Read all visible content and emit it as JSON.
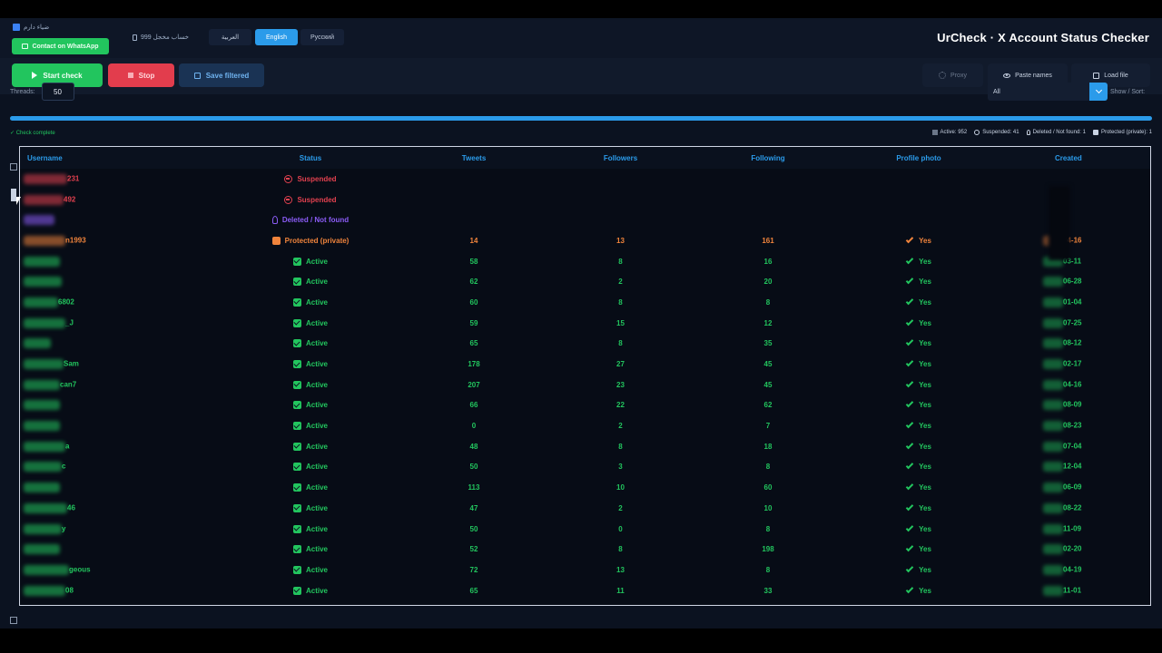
{
  "header": {
    "user_name": "ضياء دارم",
    "whatsapp_label": "Contact on WhatsApp",
    "accounts_label": "خساب مخجل 999",
    "languages": [
      {
        "label": "العربية",
        "active": false
      },
      {
        "label": "English",
        "active": true
      },
      {
        "label": "Русский",
        "active": false
      }
    ],
    "app_title": "UrCheck  ·  X Account Status Checker"
  },
  "toolbar": {
    "start_label": "Start check",
    "stop_label": "Stop",
    "save_label": "Save filtered",
    "proxy_label": "Proxy",
    "paste_label": "Paste names",
    "load_label": "Load file"
  },
  "controls": {
    "threads_label": "Threads:",
    "threads_value": "50",
    "filter_value": "All",
    "sort_label": "Show / Sort:"
  },
  "progress": {
    "fraction": 1.0,
    "status_text": "✓ Check complete",
    "stats": [
      {
        "label": "Active: 952",
        "color": "#c9d3e3"
      },
      {
        "label": "Suspended: 41",
        "color": "#c9d3e3"
      },
      {
        "label": "Deleted / Not found: 1",
        "color": "#c9d3e3"
      },
      {
        "label": "Protected (private): 1",
        "color": "#c9d3e3"
      }
    ]
  },
  "table": {
    "columns": [
      "Username",
      "Status",
      "Tweets",
      "Followers",
      "Following",
      "Profile photo",
      "Created"
    ],
    "rows": [
      {
        "user_suffix": "231",
        "status": "Suspended",
        "type": "suspended",
        "tweets": "",
        "followers": "",
        "following": "",
        "photo": "",
        "created": ""
      },
      {
        "user_suffix": "492",
        "status": "Suspended",
        "type": "suspended",
        "tweets": "",
        "followers": "",
        "following": "",
        "photo": "",
        "created": ""
      },
      {
        "user_suffix": "",
        "status": "Deleted / Not found",
        "type": "deleted",
        "tweets": "",
        "followers": "",
        "following": "",
        "photo": "",
        "created": ""
      },
      {
        "user_suffix": "n1993",
        "status": "Protected (private)",
        "type": "protected",
        "tweets": "14",
        "followers": "13",
        "following": "161",
        "photo": "Yes",
        "created": "04-16"
      },
      {
        "user_suffix": "",
        "status": "Active",
        "type": "active",
        "tweets": "58",
        "followers": "8",
        "following": "16",
        "photo": "Yes",
        "created": "03-11"
      },
      {
        "user_suffix": "",
        "status": "Active",
        "type": "active",
        "tweets": "62",
        "followers": "2",
        "following": "20",
        "photo": "Yes",
        "created": "06-28"
      },
      {
        "user_suffix": "6802",
        "status": "Active",
        "type": "active",
        "tweets": "60",
        "followers": "8",
        "following": "8",
        "photo": "Yes",
        "created": "01-04"
      },
      {
        "user_suffix": "_J",
        "status": "Active",
        "type": "active",
        "tweets": "59",
        "followers": "15",
        "following": "12",
        "photo": "Yes",
        "created": "07-25"
      },
      {
        "user_suffix": "",
        "status": "Active",
        "type": "active",
        "tweets": "65",
        "followers": "8",
        "following": "35",
        "photo": "Yes",
        "created": "08-12"
      },
      {
        "user_suffix": "Sam",
        "status": "Active",
        "type": "active",
        "tweets": "178",
        "followers": "27",
        "following": "45",
        "photo": "Yes",
        "created": "02-17"
      },
      {
        "user_suffix": "can7",
        "status": "Active",
        "type": "active",
        "tweets": "207",
        "followers": "23",
        "following": "45",
        "photo": "Yes",
        "created": "04-16"
      },
      {
        "user_suffix": "",
        "status": "Active",
        "type": "active",
        "tweets": "66",
        "followers": "22",
        "following": "62",
        "photo": "Yes",
        "created": "08-09"
      },
      {
        "user_suffix": "",
        "status": "Active",
        "type": "active",
        "tweets": "0",
        "followers": "2",
        "following": "7",
        "photo": "Yes",
        "created": "08-23"
      },
      {
        "user_suffix": "a",
        "status": "Active",
        "type": "active",
        "tweets": "48",
        "followers": "8",
        "following": "18",
        "photo": "Yes",
        "created": "07-04"
      },
      {
        "user_suffix": "c",
        "status": "Active",
        "type": "active",
        "tweets": "50",
        "followers": "3",
        "following": "8",
        "photo": "Yes",
        "created": "12-04"
      },
      {
        "user_suffix": "",
        "status": "Active",
        "type": "active",
        "tweets": "113",
        "followers": "10",
        "following": "60",
        "photo": "Yes",
        "created": "06-09"
      },
      {
        "user_suffix": "46",
        "status": "Active",
        "type": "active",
        "tweets": "47",
        "followers": "2",
        "following": "10",
        "photo": "Yes",
        "created": "08-22"
      },
      {
        "user_suffix": "y",
        "status": "Active",
        "type": "active",
        "tweets": "50",
        "followers": "0",
        "following": "8",
        "photo": "Yes",
        "created": "11-09"
      },
      {
        "user_suffix": "",
        "status": "Active",
        "type": "active",
        "tweets": "52",
        "followers": "8",
        "following": "198",
        "photo": "Yes",
        "created": "02-20"
      },
      {
        "user_suffix": "geous",
        "status": "Active",
        "type": "active",
        "tweets": "72",
        "followers": "13",
        "following": "8",
        "photo": "Yes",
        "created": "04-19"
      },
      {
        "user_suffix": "08",
        "status": "Active",
        "type": "active",
        "tweets": "65",
        "followers": "11",
        "following": "33",
        "photo": "Yes",
        "created": "11-01"
      }
    ]
  },
  "colors": {
    "active": "#22c55e",
    "suspended": "#e2414f",
    "deleted": "#8b5cf6",
    "protected": "#f0843c",
    "accent": "#2b9bea"
  }
}
